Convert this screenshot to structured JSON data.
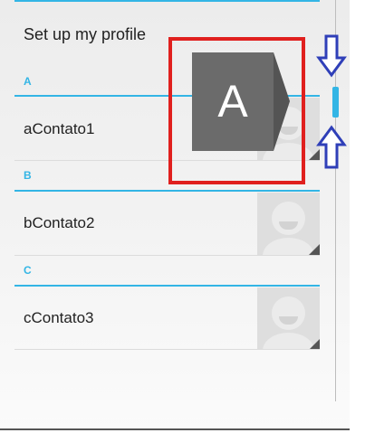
{
  "profile": {
    "label": "Set up my profile"
  },
  "sections": [
    {
      "header": "A",
      "contact": "aContato1"
    },
    {
      "header": "B",
      "contact": "bContato2"
    },
    {
      "header": "C",
      "contact": "cContato3"
    }
  ],
  "fast_scroll": {
    "current_section_letter": "A"
  },
  "colors": {
    "accent": "#33b5e5",
    "indicator_bg": "#6b6b6b",
    "annotation_box": "#e0201e",
    "annotation_arrow": "#2f3fb8"
  },
  "icons": {
    "avatar": "default-contact-avatar-icon",
    "arrow_down": "arrow-down-icon",
    "arrow_up": "arrow-up-icon"
  }
}
